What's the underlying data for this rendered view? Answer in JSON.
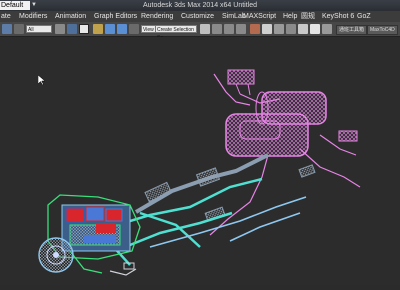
{
  "title_bar": {
    "workspace_value": "Default",
    "app_title": "Autodesk 3ds Max  2014 x64      Untitled"
  },
  "menu": {
    "items": [
      "ate",
      "Modifiers",
      "Animation",
      "Graph Editors",
      "Rendering",
      "Customize",
      "SimLab",
      "MAXScript",
      "Help",
      "圆规",
      "KeyShot 6",
      "GoZ"
    ]
  },
  "toolbar": {
    "selection_filter_value": "All",
    "view_dropdown_value": "View",
    "named_selection_placeholder": "Create Selection Se",
    "right_text_1": "通班工具箱",
    "right_text_2": "MaxToC4D"
  },
  "colors": {
    "wire_pink": "#e784e6",
    "wire_cyan": "#4fe0d2",
    "wire_light_blue": "#8ec8f0",
    "gray_blue_wire": "#8b9db0",
    "engine_red": "#d8262c",
    "engine_blue": "#4a78d6",
    "engine_green": "#39e07a",
    "viewport_bg": "#2c2c2c"
  },
  "icons": [
    "undo-icon",
    "redo-icon",
    "select-icon",
    "select-by-name-icon",
    "rect-select-icon",
    "window-crossing-icon",
    "move-icon",
    "rotate-icon",
    "scale-icon",
    "snap-icon",
    "angle-snap-icon",
    "percent-snap-icon",
    "spinner-snap-icon",
    "mirror-icon",
    "align-icon",
    "layer-icon",
    "ribbon-icon",
    "curve-editor-icon",
    "schematic-icon",
    "material-editor-icon",
    "render-setup-icon",
    "render-frame-icon",
    "render-icon"
  ]
}
